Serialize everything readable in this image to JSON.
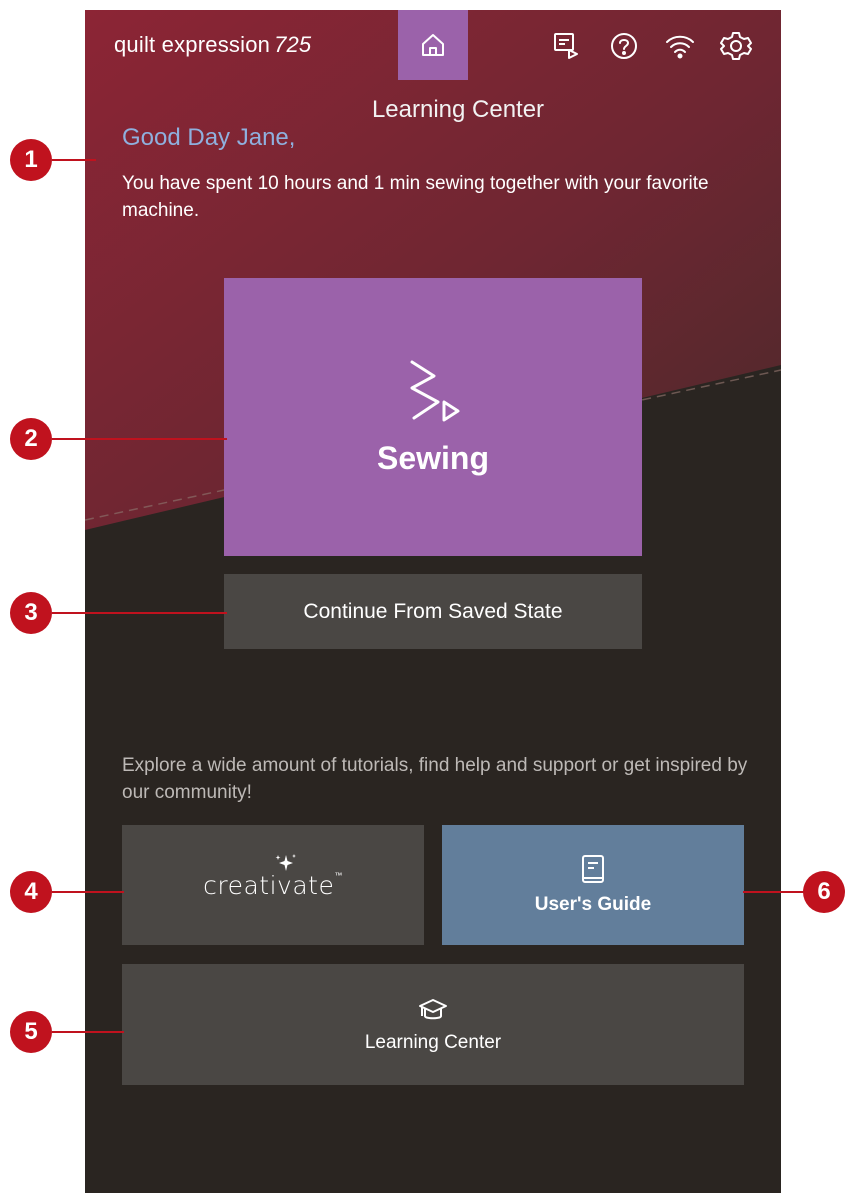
{
  "header": {
    "brand_name": "quilt expression",
    "brand_model": "725",
    "page_title": "Learning Center",
    "icons": [
      "home-icon",
      "tutorial-screen-icon",
      "help-icon",
      "wifi-icon",
      "settings-icon"
    ]
  },
  "welcome": {
    "greeting": "Good Day Jane,",
    "message": "You have spent 10 hours and 1 min sewing together with your favorite machine."
  },
  "main": {
    "sewing_label": "Sewing",
    "continue_label": "Continue From Saved State"
  },
  "explore": {
    "text": "Explore a wide amount of tutorials, find help and support or get inspired by our community!",
    "creativate_logo_text": "creativate",
    "users_guide_label": "User's Guide",
    "learning_center_label": "Learning Center"
  },
  "callouts": [
    "1",
    "2",
    "3",
    "4",
    "5",
    "6"
  ],
  "colors": {
    "header_gradient_top": "#8c2535",
    "accent_purple": "#9b62aa",
    "guide_blue": "#627e9b",
    "tile_gray": "#4a4744",
    "background_dark": "#2a2521",
    "greeting_blue": "#8fb0de",
    "callout_red": "#c0121e"
  }
}
